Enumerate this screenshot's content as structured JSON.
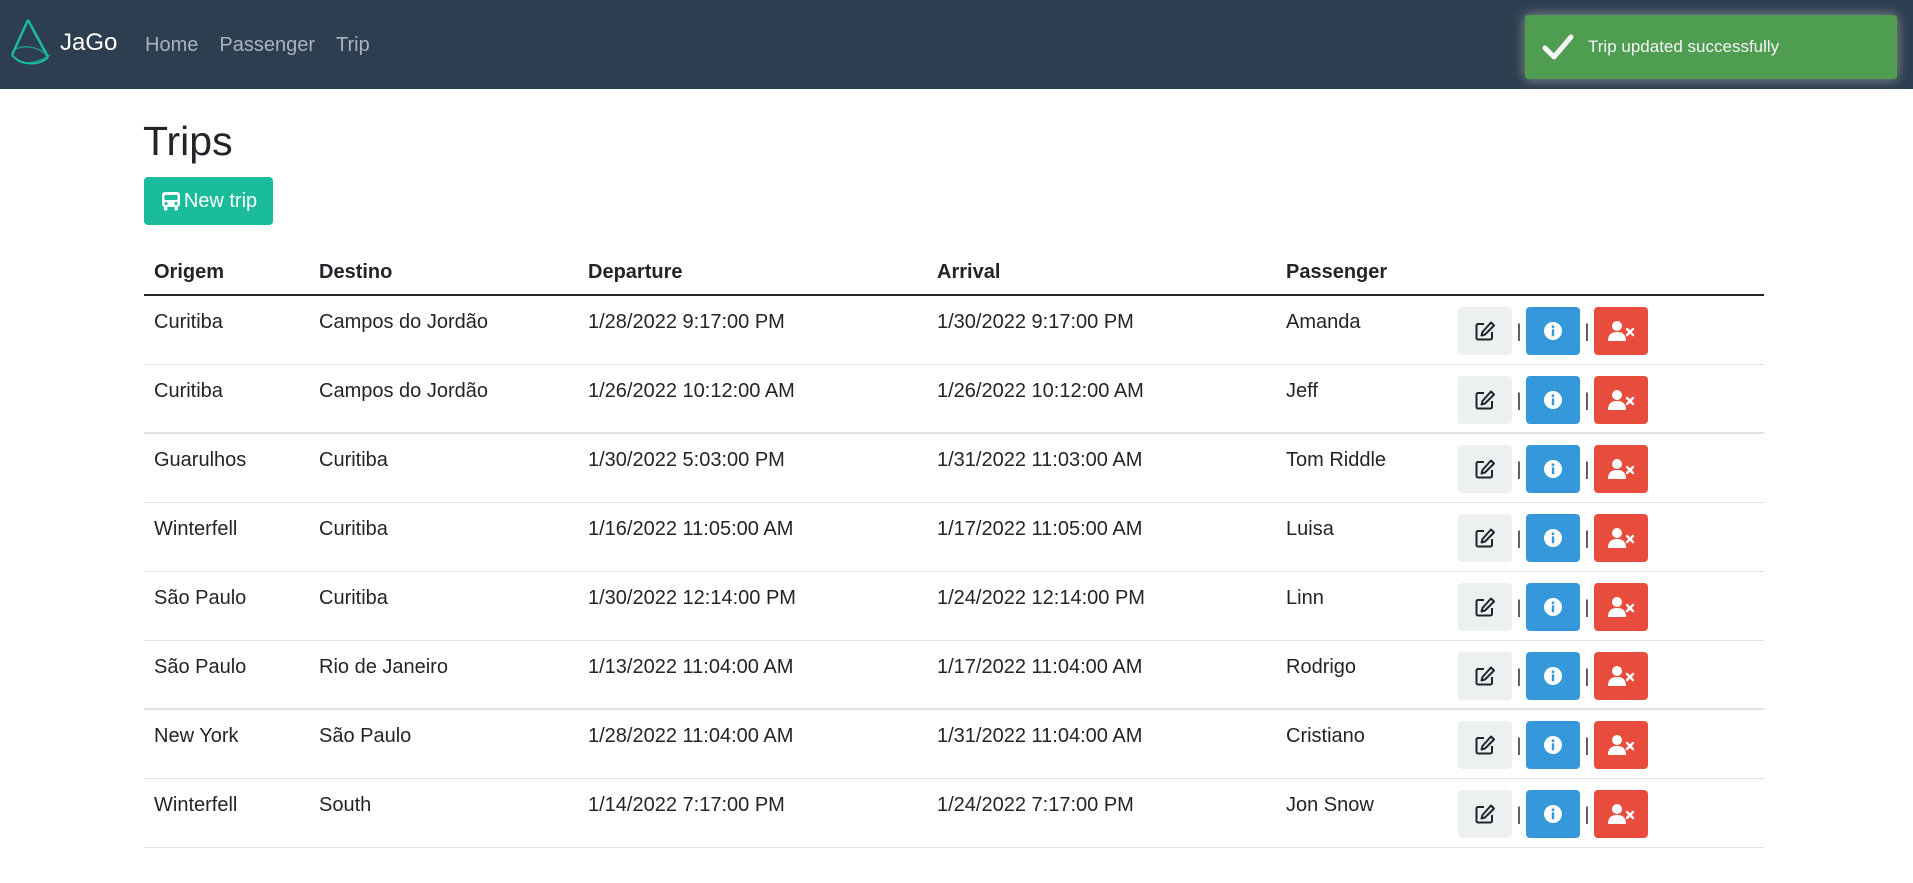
{
  "navbar": {
    "brand": "JaGo",
    "links": [
      "Home",
      "Passenger",
      "Trip"
    ]
  },
  "toast": {
    "message": "Trip updated successfully",
    "color": "#51a351"
  },
  "page": {
    "title": "Trips",
    "new_button": "New trip"
  },
  "table": {
    "headers": [
      "Origem",
      "Destino",
      "Departure",
      "Arrival",
      "Passenger"
    ],
    "rows": [
      [
        "Curitiba",
        "Campos do Jordão",
        "1/28/2022 9:17:00 PM",
        "1/30/2022 9:17:00 PM",
        "Amanda"
      ],
      [
        "Curitiba",
        "Campos do Jordão",
        "1/26/2022 10:12:00 AM",
        "1/26/2022 10:12:00 AM",
        "Jeff"
      ],
      [
        "Guarulhos",
        "Curitiba",
        "1/30/2022 5:03:00 PM",
        "1/31/2022 11:03:00 AM",
        "Tom Riddle"
      ],
      [
        "Winterfell",
        "Curitiba",
        "1/16/2022 11:05:00 AM",
        "1/17/2022 11:05:00 AM",
        "Luisa"
      ],
      [
        "São Paulo",
        "Curitiba",
        "1/30/2022 12:14:00 PM",
        "1/24/2022 12:14:00 PM",
        "Linn"
      ],
      [
        "São Paulo",
        "Rio de Janeiro",
        "1/13/2022 11:04:00 AM",
        "1/17/2022 11:04:00 AM",
        "Rodrigo"
      ],
      [
        "New York",
        "São Paulo",
        "1/28/2022 11:04:00 AM",
        "1/31/2022 11:04:00 AM",
        "Cristiano"
      ],
      [
        "Winterfell",
        "South",
        "1/14/2022 7:17:00 PM",
        "1/24/2022 7:17:00 PM",
        "Jon Snow"
      ]
    ],
    "separator": "|",
    "action_icons": [
      "edit-icon",
      "info-icon",
      "remove-user-icon"
    ]
  },
  "colors": {
    "navbar": "#2c3e50",
    "success": "#1abc9c",
    "info": "#3498db",
    "danger": "#e74c3c",
    "light": "#ecf0f1"
  }
}
